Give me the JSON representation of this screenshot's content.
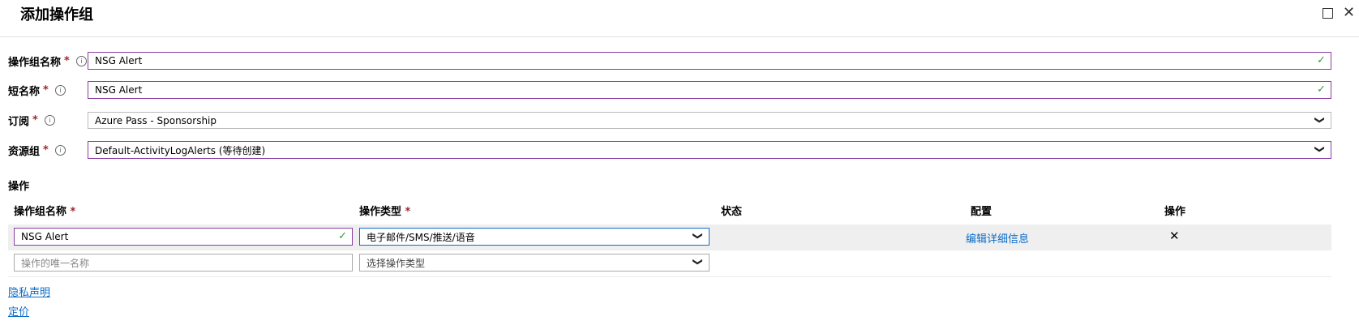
{
  "window": {
    "title": "添加操作组",
    "maximize_icon": "□",
    "close_icon": "✕"
  },
  "form": {
    "action_group_name": {
      "label": "操作组名称",
      "value": "NSG Alert"
    },
    "short_name": {
      "label": "短名称",
      "value": "NSG Alert"
    },
    "subscription": {
      "label": "订阅",
      "value": "Azure Pass - Sponsorship"
    },
    "resource_group": {
      "label": "资源组",
      "value": "Default-ActivityLogAlerts (等待创建)"
    }
  },
  "actions_section": {
    "title": "操作",
    "headers": {
      "name": "操作组名称",
      "type": "操作类型",
      "status": "状态",
      "config": "配置",
      "action": "操作"
    },
    "rows": [
      {
        "name": "NSG Alert",
        "type": "电子邮件/SMS/推送/语音",
        "config_link": "编辑详细信息",
        "delete_icon": "✕"
      }
    ],
    "new_row": {
      "name_placeholder": "操作的唯一名称",
      "type_placeholder": "选择操作类型"
    }
  },
  "footer_links": {
    "privacy": "隐私声明",
    "pricing": "定价"
  },
  "required_marker": "*",
  "info_icon": "i",
  "check_icon": "✓",
  "chevron_icon": "❯"
}
